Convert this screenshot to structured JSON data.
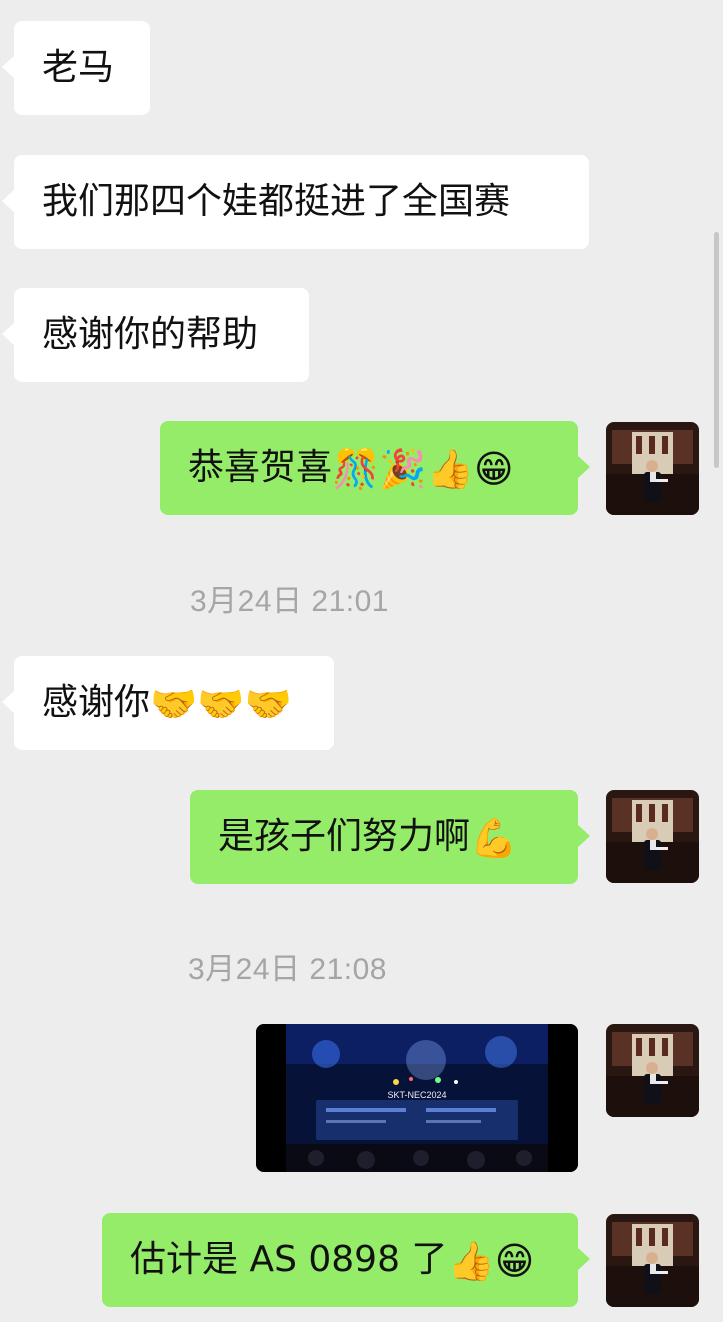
{
  "messages": [
    {
      "text": "老马",
      "emoji": ""
    },
    {
      "text": "我们那四个娃都挺进了全国赛",
      "emoji": ""
    },
    {
      "text": "感谢你的帮助",
      "emoji": ""
    },
    {
      "text": "恭喜贺喜",
      "emoji": "🎊🎉👍😁"
    },
    {
      "text": "感谢你",
      "emoji": "🤝🤝🤝"
    },
    {
      "text": "是孩子们努力啊",
      "emoji": "💪"
    },
    {
      "text": "估计是 AS 0898 了",
      "emoji": "👍😁"
    }
  ],
  "timestamps": [
    "3月24日 21:01",
    "3月24日 21:08"
  ],
  "video": {
    "screen_title": "SKT-NEC2024"
  },
  "avatar_icon": "user-avatar-icon",
  "colors": {
    "background": "#ededed",
    "incoming_bubble": "#ffffff",
    "outgoing_bubble": "#95ec69",
    "timestamp_text": "#a5a5a5"
  }
}
